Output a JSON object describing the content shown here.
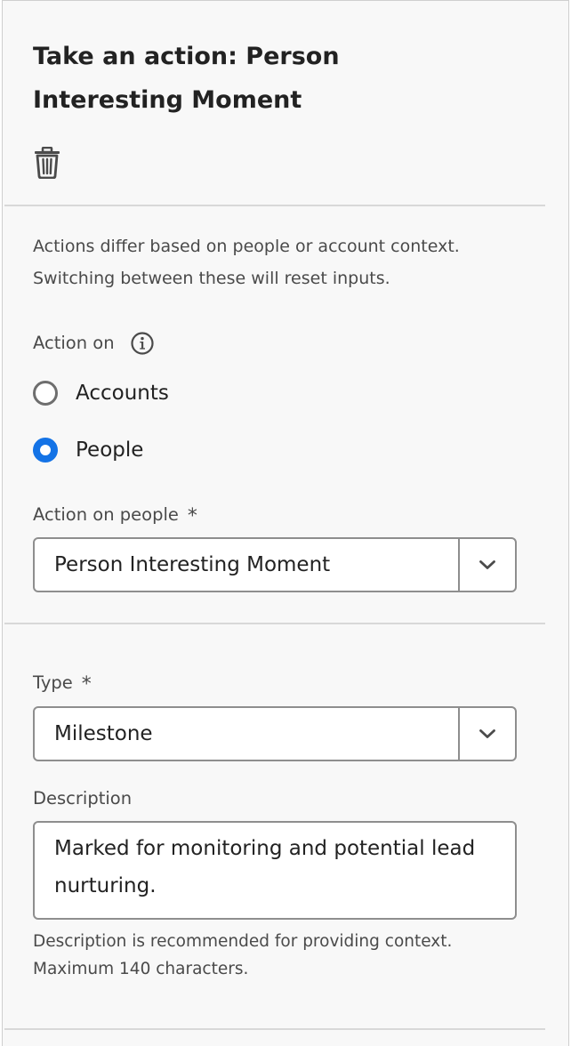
{
  "panel": {
    "title": "Take an action: Person Interesting Moment",
    "delete_icon": "trash-icon"
  },
  "context_help": {
    "line1": "Actions differ based on people or account context.",
    "line2": "Switching between these will reset inputs."
  },
  "action_on": {
    "label": "Action on",
    "info_icon": "info-icon",
    "options": [
      {
        "label": "Accounts",
        "selected": false
      },
      {
        "label": "People",
        "selected": true
      }
    ]
  },
  "action_on_people": {
    "label": "Action on people",
    "required_marker": "*",
    "value": "Person Interesting Moment",
    "chevron_icon": "chevron-down-icon"
  },
  "type": {
    "label": "Type",
    "required_marker": "*",
    "value": "Milestone",
    "chevron_icon": "chevron-down-icon"
  },
  "description": {
    "label": "Description",
    "value": "Marked for monitoring and potential lead nurturing.",
    "hint_line1": "Description is recommended for providing context.",
    "hint_line2": "Maximum 140 characters."
  },
  "colors": {
    "accent": "#1473e6",
    "panel_background": "#f8f8f8",
    "text": "#222222",
    "secondary_text": "#4a4a4a",
    "border": "#8e8e8e"
  }
}
